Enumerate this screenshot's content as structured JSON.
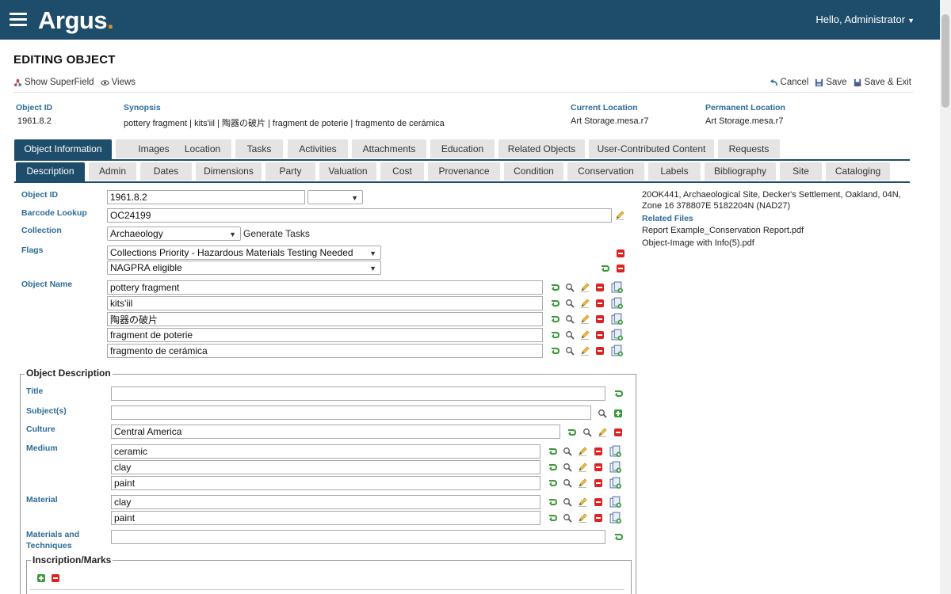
{
  "app": {
    "name": "Argus",
    "name_dot": ".",
    "greeting": "Hello, Administrator"
  },
  "page": {
    "title": "EDITING OBJECT"
  },
  "toolbar": {
    "show_superfield": "Show SuperField",
    "views": "Views",
    "cancel": "Cancel",
    "save": "Save",
    "save_exit": "Save & Exit"
  },
  "summary": {
    "object_id_label": "Object ID",
    "object_id": "1961.8.2",
    "synopsis_label": "Synopsis",
    "synopsis": "pottery fragment | kits'iil | 陶器の破片 | fragment de poterie | fragmento de cerámica",
    "current_location_label": "Current Location",
    "current_location": "Art Storage.mesa.r7",
    "permanent_location_label": "Permanent Location",
    "permanent_location": "Art Storage.mesa.r7"
  },
  "tabs_primary": [
    "Object Information",
    "Images",
    "Location",
    "Tasks",
    "Activities",
    "Attachments",
    "Education",
    "Related Objects",
    "User-Contributed Content",
    "Requests"
  ],
  "tabs_secondary": [
    "Description",
    "Admin",
    "Dates",
    "Dimensions",
    "Party",
    "Valuation",
    "Cost",
    "Provenance",
    "Condition",
    "Conservation",
    "Labels",
    "Bibliography",
    "Site",
    "Cataloging"
  ],
  "form": {
    "object_id_label": "Object ID",
    "object_id": "1961.8.2",
    "barcode_label": "Barcode Lookup",
    "barcode": "OC24199",
    "collection_label": "Collection",
    "collection": "Archaeology",
    "generate_tasks": "Generate Tasks",
    "flags_label": "Flags",
    "flags": [
      "Collections Priority - Hazardous Materials Testing Needed",
      "NAGPRA eligible"
    ],
    "object_name_label": "Object Name",
    "object_names": [
      "pottery fragment",
      "kits'iil",
      "陶器の破片",
      "fragment de poterie",
      "fragmento de cerámica"
    ]
  },
  "right_panel": {
    "site_info": "20OK441, Archaeological Site, Decker's Settlement, Oakland, 04N, Zone 16 378807E 5182204N (NAD27)",
    "related_files_label": "Related Files",
    "related_files": [
      "Report Example_Conservation Report.pdf",
      "Object-Image with Info(5).pdf"
    ]
  },
  "description": {
    "legend": "Object Description",
    "title_label": "Title",
    "title": "",
    "subjects_label": "Subject(s)",
    "subjects": "",
    "culture_label": "Culture",
    "culture": "Central America",
    "medium_label": "Medium",
    "medium": [
      "ceramic",
      "clay",
      "paint"
    ],
    "material_label": "Material",
    "material": [
      "clay",
      "paint"
    ],
    "materials_techniques_label": "Materials and Techniques",
    "materials_techniques": "",
    "inscription_legend": "Inscription/Marks"
  },
  "colors": {
    "header": "#1e4d6b",
    "label": "#2b6c9a",
    "logo_dot": "#f28c1e"
  }
}
